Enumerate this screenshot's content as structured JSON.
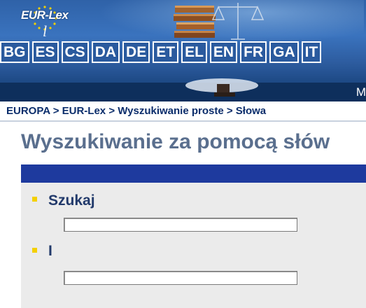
{
  "banner": {
    "logo_text": "EUR-Lex",
    "languages": [
      "BG",
      "ES",
      "CS",
      "DA",
      "DE",
      "ET",
      "EL",
      "EN",
      "FR",
      "GA",
      "IT"
    ],
    "cutoff_letter": "M"
  },
  "breadcrumb": {
    "items": [
      "EUROPA",
      "EUR-Lex",
      "Wyszukiwanie proste",
      "Słowa"
    ],
    "separator": ">"
  },
  "page": {
    "title": "Wyszukiwanie za pomocą słów"
  },
  "form": {
    "fields": [
      {
        "label": "Szukaj",
        "value": ""
      },
      {
        "label": "I",
        "value": ""
      }
    ]
  },
  "colors": {
    "banner_blue": "#2f62a8",
    "header_bar": "#1e3a9e",
    "bullet_yellow": "#f4d000",
    "title_gray_blue": "#5a6f8e"
  }
}
